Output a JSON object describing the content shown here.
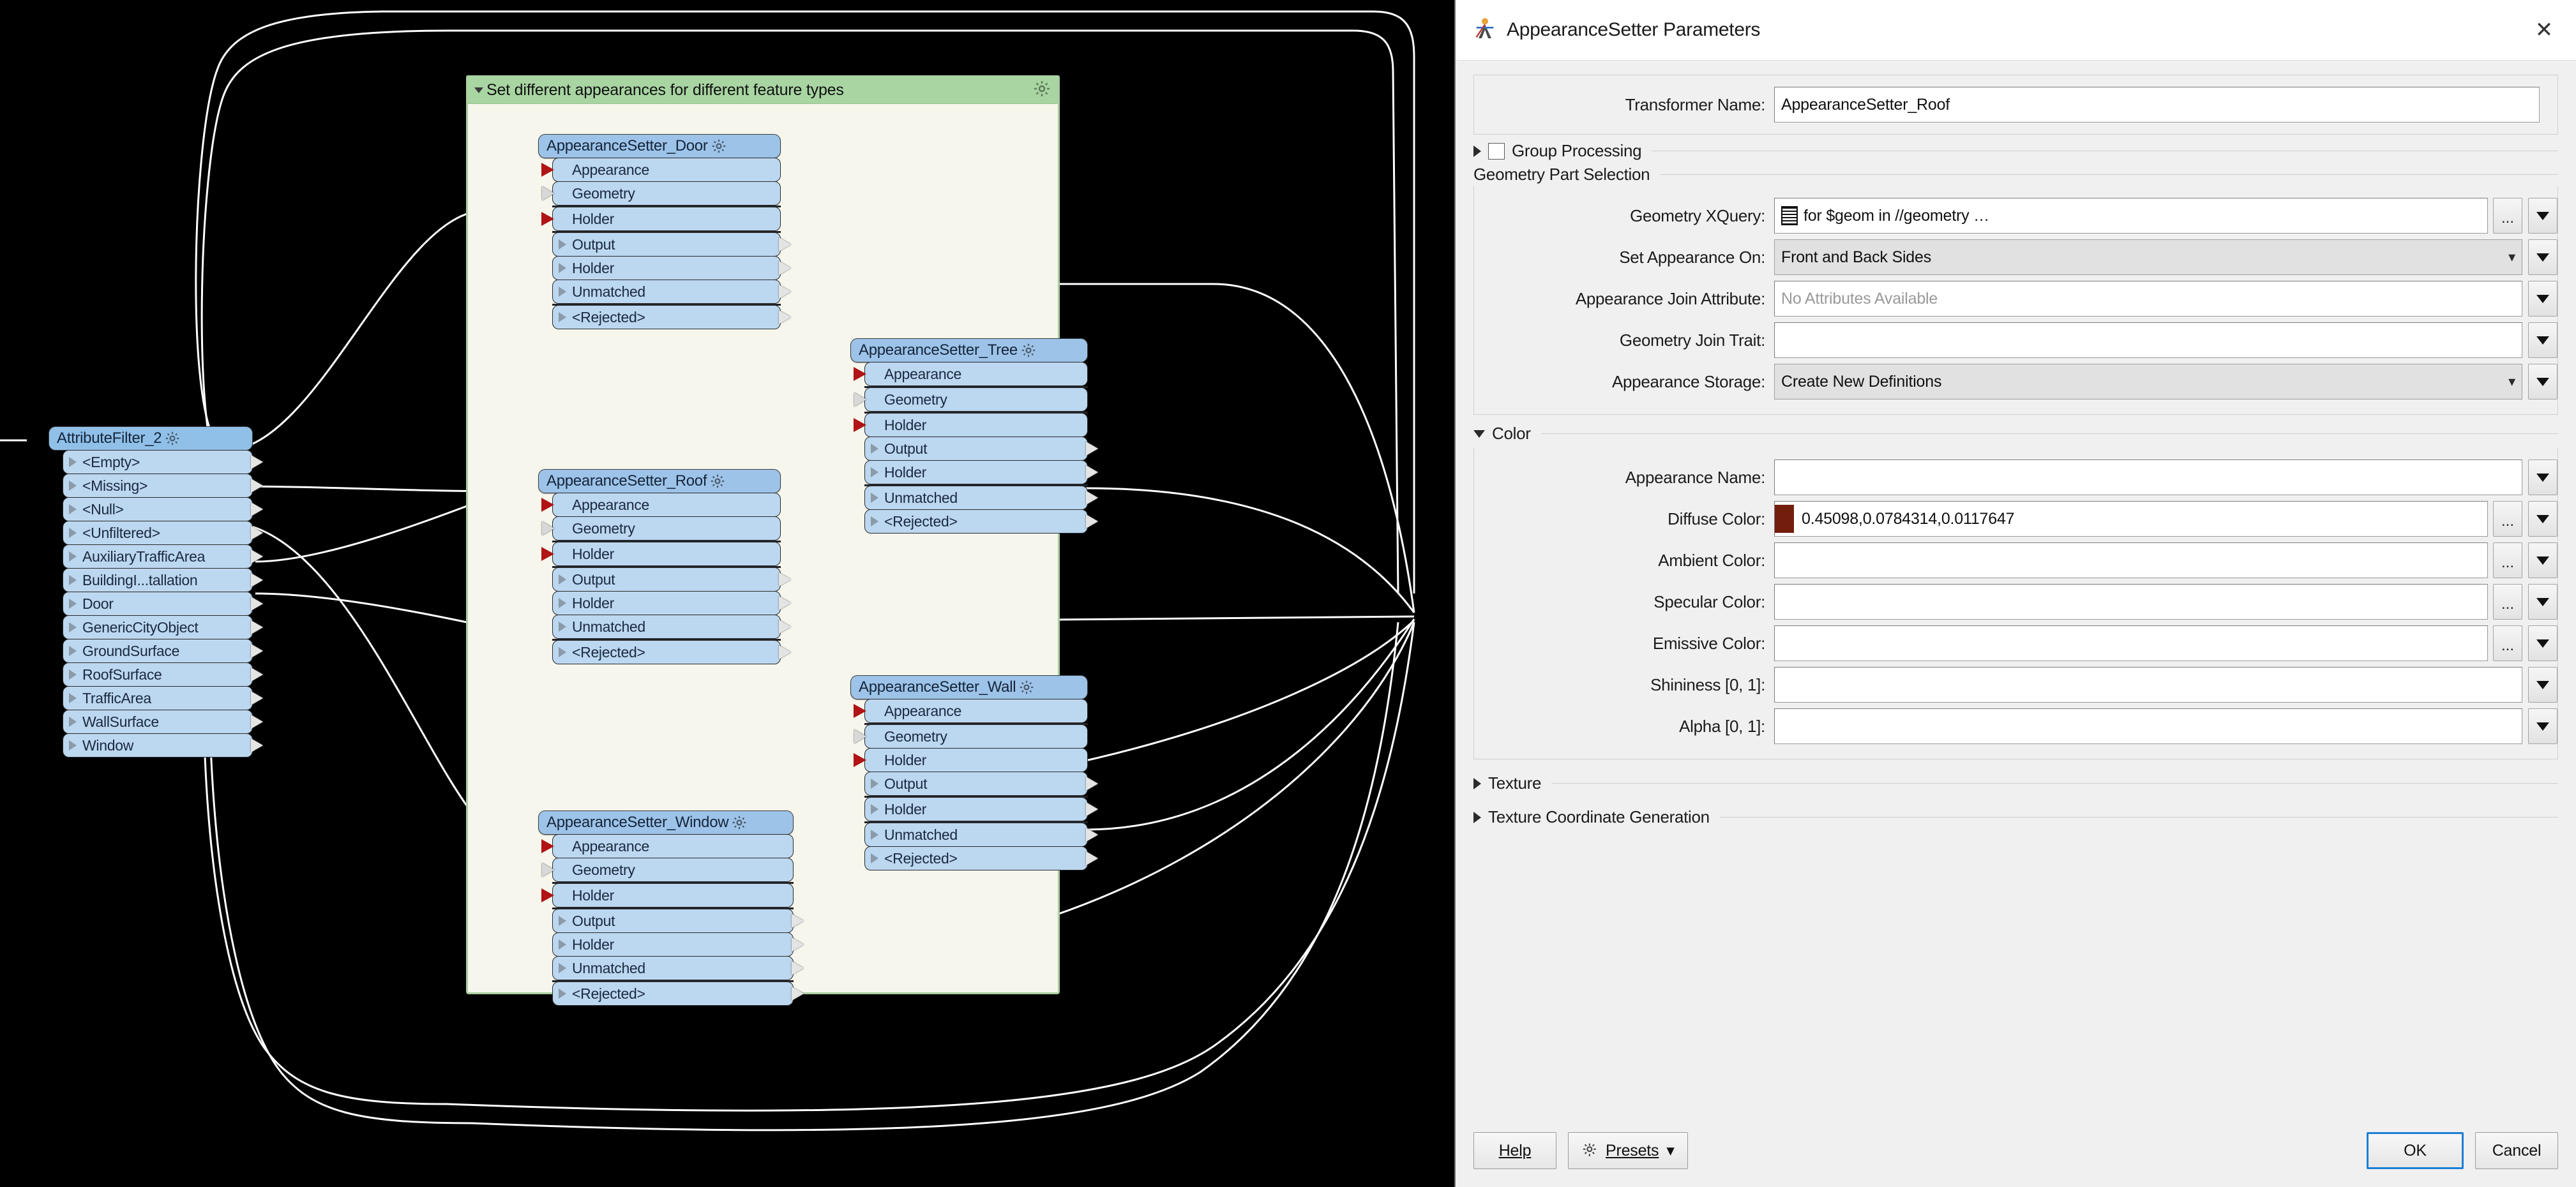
{
  "dialog": {
    "title": "AppearanceSetter Parameters",
    "close_label": "✕",
    "transformer_name_label": "Transformer Name:",
    "transformer_name_value": "AppearanceSetter_Roof",
    "group_processing_label": "Group Processing",
    "geometry_part_selection_label": "Geometry Part Selection",
    "fields": {
      "geometry_xquery": {
        "label": "Geometry XQuery:",
        "value": "for $geom in //geometry …",
        "ellipsis": "…"
      },
      "set_appearance_on": {
        "label": "Set Appearance On:",
        "value": "Front and Back Sides"
      },
      "appearance_join_attribute": {
        "label": "Appearance Join Attribute:",
        "placeholder": "No Attributes Available",
        "value": ""
      },
      "geometry_join_trait": {
        "label": "Geometry Join Trait:",
        "value": ""
      },
      "appearance_storage": {
        "label": "Appearance Storage:",
        "value": "Create New Definitions"
      },
      "appearance_name": {
        "label": "Appearance Name:",
        "value": ""
      },
      "diffuse_color": {
        "label": "Diffuse Color:",
        "value": "0.45098,0.0784314,0.0117647",
        "swatch": "#731d0d"
      },
      "ambient_color": {
        "label": "Ambient Color:",
        "value": ""
      },
      "specular_color": {
        "label": "Specular Color:",
        "value": ""
      },
      "emissive_color": {
        "label": "Emissive Color:",
        "value": ""
      },
      "shininess": {
        "label": "Shininess [0, 1]:",
        "value": ""
      },
      "alpha": {
        "label": "Alpha [0, 1]:",
        "value": ""
      }
    },
    "sections": {
      "color": "Color",
      "texture": "Texture",
      "texture_coordinate_generation": "Texture Coordinate Generation"
    },
    "footer": {
      "help": "Help",
      "presets": "Presets",
      "ok": "OK",
      "cancel": "Cancel"
    }
  },
  "canvas": {
    "bookmark": {
      "title": "Set different appearances for different feature types"
    },
    "attribute_filter": {
      "name": "AttributeFilter_2",
      "ports": [
        "<Empty>",
        "<Missing>",
        "<Null>",
        "<Unfiltered>",
        "AuxiliaryTrafficArea",
        "BuildingI...tallation",
        "Door",
        "GenericCityObject",
        "GroundSurface",
        "RoofSurface",
        "TrafficArea",
        "WallSurface",
        "Window"
      ]
    },
    "nodes": [
      {
        "name": "AppearanceSetter_Door",
        "ports": [
          "Appearance",
          "Geometry",
          "Holder",
          "Output",
          "Holder",
          "Unmatched",
          "<Rejected>"
        ]
      },
      {
        "name": "AppearanceSetter_Roof",
        "ports": [
          "Appearance",
          "Geometry",
          "Holder",
          "Output",
          "Holder",
          "Unmatched",
          "<Rejected>"
        ]
      },
      {
        "name": "AppearanceSetter_Window",
        "ports": [
          "Appearance",
          "Geometry",
          "Holder",
          "Output",
          "Holder",
          "Unmatched",
          "<Rejected>"
        ]
      },
      {
        "name": "AppearanceSetter_Tree",
        "ports": [
          "Appearance",
          "Geometry",
          "Holder",
          "Output",
          "Holder",
          "Unmatched",
          "<Rejected>"
        ]
      },
      {
        "name": "AppearanceSetter_Wall",
        "ports": [
          "Appearance",
          "Geometry",
          "Holder",
          "Output",
          "Holder",
          "Unmatched",
          "<Rejected>"
        ]
      }
    ]
  },
  "colors": {
    "canvas_bg": "#000000",
    "bookmark_header": "#a8d5a2",
    "bookmark_body": "#f6f6ec",
    "node_header": "#9dc3e8",
    "node_port": "#bcd7f0",
    "required_arrow": "#b01414",
    "accent_blue": "#1b7fd4"
  }
}
